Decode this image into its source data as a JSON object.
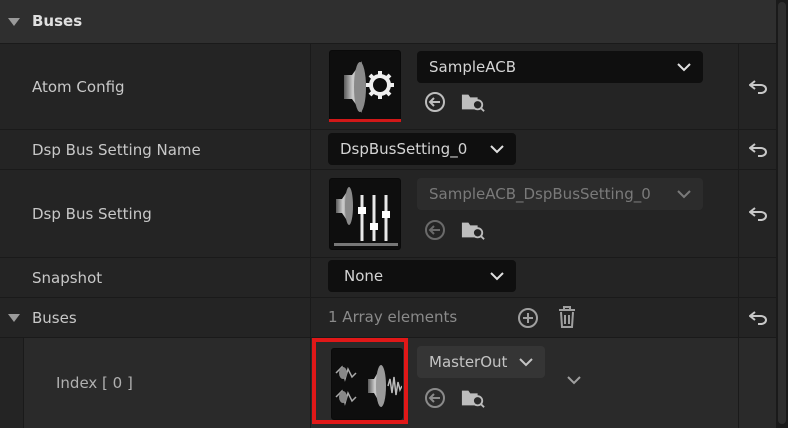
{
  "category": {
    "label": "Buses"
  },
  "rows": {
    "atom_config": {
      "label": "Atom Config",
      "thumbnail_icon": "speaker-gear-icon",
      "value": "SampleACB"
    },
    "dsp_bus_setting_name": {
      "label": "Dsp Bus Setting Name",
      "value": "DspBusSetting_0"
    },
    "dsp_bus_setting": {
      "label": "Dsp Bus Setting",
      "thumbnail_icon": "speaker-mixer-icon",
      "value": "SampleACB_DspBusSetting_0",
      "disabled": true
    },
    "snapshot": {
      "label": "Snapshot",
      "value": "None"
    },
    "buses": {
      "label": "Buses",
      "summary": "1 Array elements"
    },
    "index0": {
      "label": "Index [ 0 ]",
      "thumbnail_icon": "speaker-waveform-icon",
      "value": "MasterOut"
    }
  },
  "colors": {
    "highlight": "#e01818",
    "panel_bg": "#242424",
    "category_bg": "#2f2f2f",
    "combo_bg": "#0f0f0f"
  }
}
